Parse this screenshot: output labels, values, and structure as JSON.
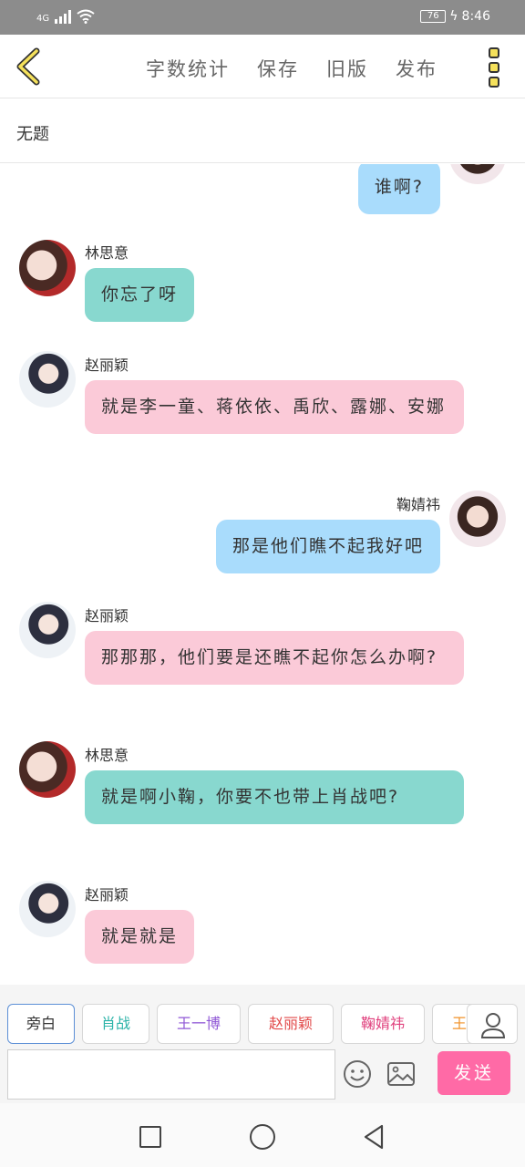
{
  "status_bar": {
    "network": "4G",
    "battery": "76",
    "time": "8:46"
  },
  "toolbar": {
    "actions": [
      "字数统计",
      "保存",
      "旧版",
      "发布"
    ]
  },
  "document": {
    "title": "无题"
  },
  "messages": [
    {
      "speaker": "",
      "text": "谁啊?",
      "side": "right",
      "color": "#a9dcfc"
    },
    {
      "speaker": "林思意",
      "text": "你忘了呀",
      "side": "left",
      "color": "#88d8cf"
    },
    {
      "speaker": "赵丽颖",
      "text": "就是李一童、蒋依依、禹欣、露娜、安娜",
      "side": "left",
      "color": "#fbcad8"
    },
    {
      "speaker": "鞠婧祎",
      "text": "那是他们瞧不起我好吧",
      "side": "right",
      "color": "#a9dcfc"
    },
    {
      "speaker": "赵丽颖",
      "text": "那那那，他们要是还瞧不起你怎么办啊?",
      "side": "left",
      "color": "#fbcad8"
    },
    {
      "speaker": "林思意",
      "text": "就是啊小鞠，你要不也带上肖战吧?",
      "side": "left",
      "color": "#88d8cf"
    },
    {
      "speaker": "赵丽颖",
      "text": "就是就是",
      "side": "left",
      "color": "#fbcad8"
    }
  ],
  "characters": [
    {
      "label": "旁白",
      "color": "#333333",
      "selected": true
    },
    {
      "label": "肖战",
      "color": "#2bb3a8"
    },
    {
      "label": "王一博",
      "color": "#8f57d6"
    },
    {
      "label": "赵丽颖",
      "color": "#e24a4a"
    },
    {
      "label": "鞠婧祎",
      "color": "#e0407d"
    },
    {
      "label": "王",
      "color": "#f0922a"
    }
  ],
  "composer": {
    "input_value": "",
    "send_label": "发送"
  },
  "colors": {
    "accent_pink": "#ff6aa6",
    "back_arrow": "#f5e15b"
  }
}
